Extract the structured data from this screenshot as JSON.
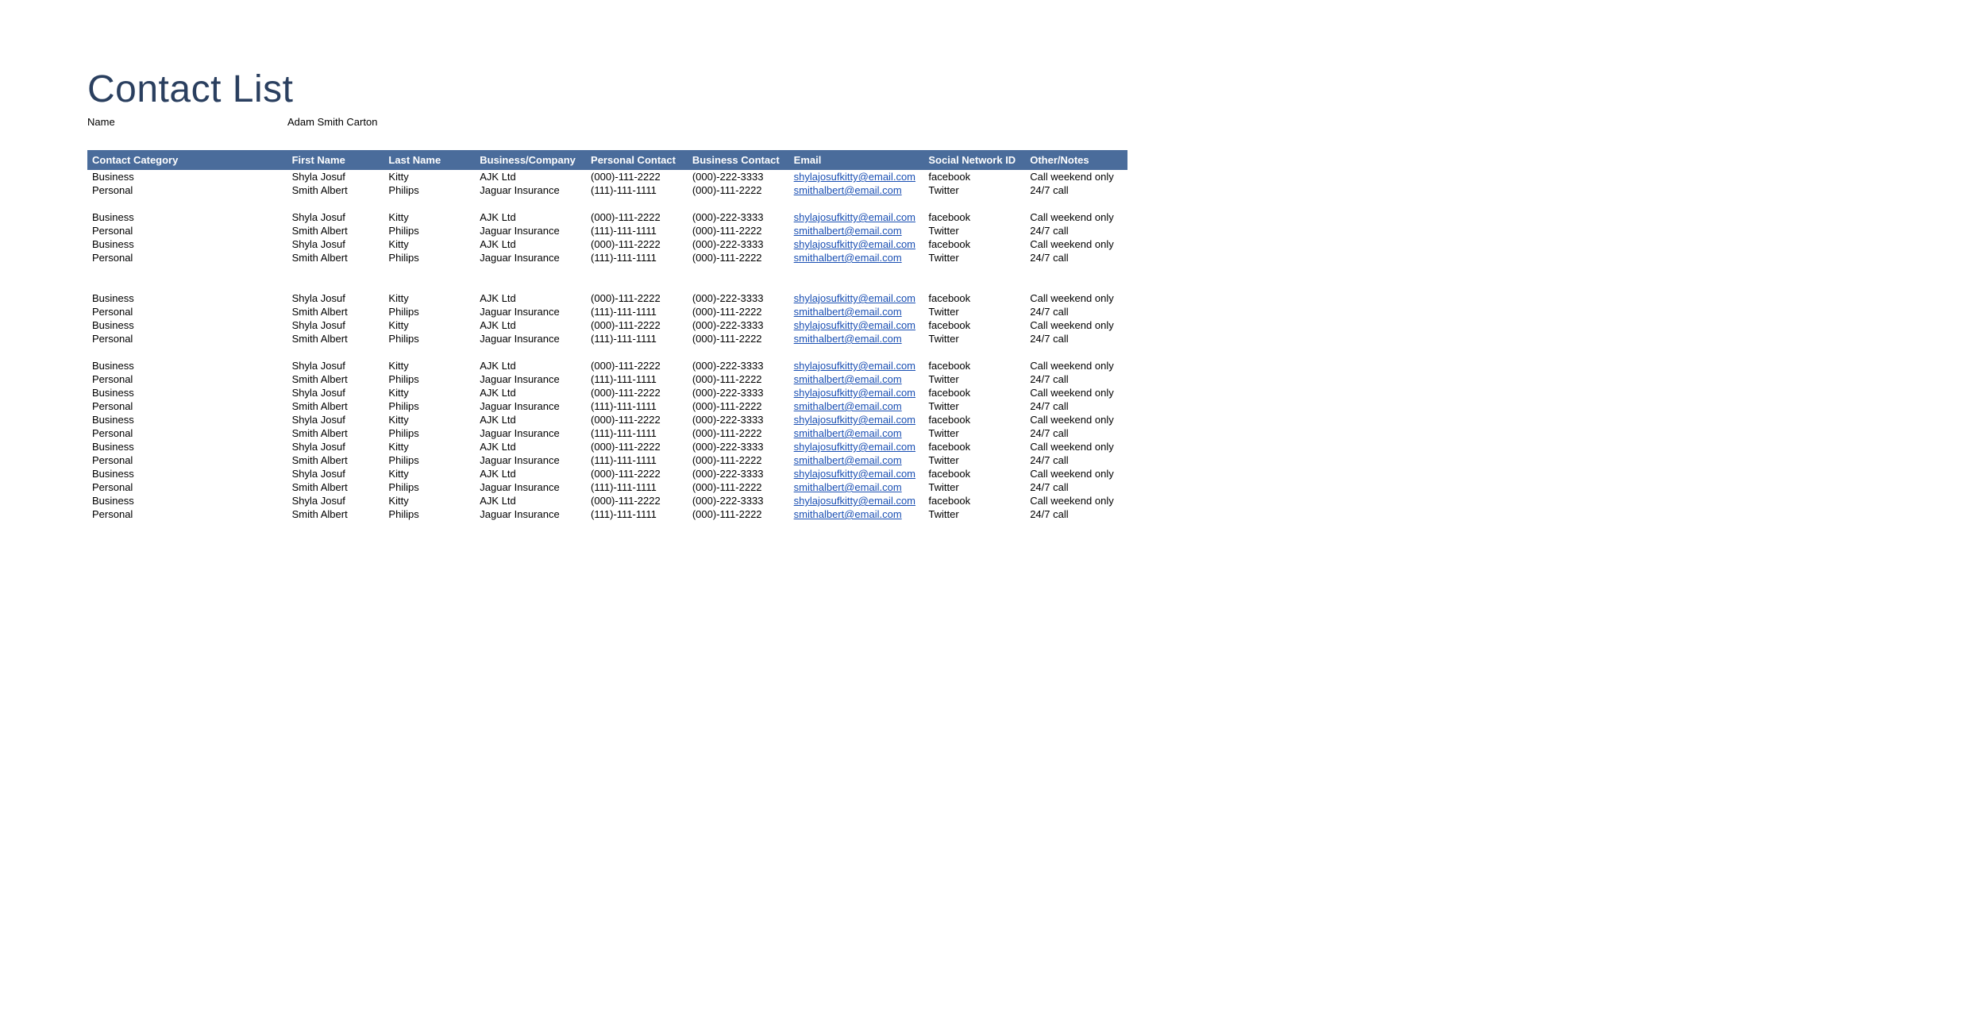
{
  "title": "Contact List",
  "meta": {
    "label": "Name",
    "value": "Adam Smith Carton"
  },
  "columns": [
    "Contact Category",
    "First Name",
    "Last Name",
    "Business/Company",
    "Personal Contact",
    "Business Contact",
    "Email",
    "Social Network ID",
    "Other/Notes"
  ],
  "rows": [
    {
      "blank": false,
      "cells": [
        "Business",
        "Shyla Josuf",
        "Kitty",
        "AJK Ltd",
        "(000)-111-2222",
        "(000)-222-3333",
        "shylajosufkitty@email.com",
        "facebook",
        "Call weekend only"
      ]
    },
    {
      "blank": false,
      "cells": [
        "Personal",
        "Smith Albert",
        "Philips",
        "Jaguar Insurance",
        "(111)-111-1111",
        "(000)-111-2222",
        "smithalbert@email.com",
        "Twitter",
        "24/7 call"
      ]
    },
    {
      "blank": true,
      "cells": [
        "",
        "",
        "",
        "",
        "",
        "",
        "",
        "",
        ""
      ]
    },
    {
      "blank": false,
      "cells": [
        "Business",
        "Shyla Josuf",
        "Kitty",
        "AJK Ltd",
        "(000)-111-2222",
        "(000)-222-3333",
        "shylajosufkitty@email.com",
        "facebook",
        "Call weekend only"
      ]
    },
    {
      "blank": false,
      "cells": [
        "Personal",
        "Smith Albert",
        "Philips",
        "Jaguar Insurance",
        "(111)-111-1111",
        "(000)-111-2222",
        "smithalbert@email.com",
        "Twitter",
        "24/7 call"
      ]
    },
    {
      "blank": false,
      "cells": [
        "Business",
        "Shyla Josuf",
        "Kitty",
        "AJK Ltd",
        "(000)-111-2222",
        "(000)-222-3333",
        "shylajosufkitty@email.com",
        "facebook",
        "Call weekend only"
      ]
    },
    {
      "blank": false,
      "cells": [
        "Personal",
        "Smith Albert",
        "Philips",
        "Jaguar Insurance",
        "(111)-111-1111",
        "(000)-111-2222",
        "smithalbert@email.com",
        "Twitter",
        "24/7 call"
      ]
    },
    {
      "blank": true,
      "cells": [
        "",
        "",
        "",
        "",
        "",
        "",
        "",
        "",
        ""
      ]
    },
    {
      "blank": true,
      "cells": [
        "",
        "",
        "",
        "",
        "",
        "",
        "",
        "",
        ""
      ]
    },
    {
      "blank": false,
      "cells": [
        "Business",
        "Shyla Josuf",
        "Kitty",
        "AJK Ltd",
        "(000)-111-2222",
        "(000)-222-3333",
        "shylajosufkitty@email.com",
        "facebook",
        "Call weekend only"
      ]
    },
    {
      "blank": false,
      "cells": [
        "Personal",
        "Smith Albert",
        "Philips",
        "Jaguar Insurance",
        "(111)-111-1111",
        "(000)-111-2222",
        "smithalbert@email.com",
        "Twitter",
        "24/7 call"
      ]
    },
    {
      "blank": false,
      "cells": [
        "Business",
        "Shyla Josuf",
        "Kitty",
        "AJK Ltd",
        "(000)-111-2222",
        "(000)-222-3333",
        "shylajosufkitty@email.com",
        "facebook",
        "Call weekend only"
      ]
    },
    {
      "blank": false,
      "cells": [
        "Personal",
        "Smith Albert",
        "Philips",
        "Jaguar Insurance",
        "(111)-111-1111",
        "(000)-111-2222",
        "smithalbert@email.com",
        "Twitter",
        "24/7 call"
      ]
    },
    {
      "blank": true,
      "cells": [
        "",
        "",
        "",
        "",
        "",
        "",
        "",
        "",
        ""
      ]
    },
    {
      "blank": false,
      "cells": [
        "Business",
        "Shyla Josuf",
        "Kitty",
        "AJK Ltd",
        "(000)-111-2222",
        "(000)-222-3333",
        "shylajosufkitty@email.com",
        "facebook",
        "Call weekend only"
      ]
    },
    {
      "blank": false,
      "cells": [
        "Personal",
        "Smith Albert",
        "Philips",
        "Jaguar Insurance",
        "(111)-111-1111",
        "(000)-111-2222",
        "smithalbert@email.com",
        "Twitter",
        "24/7 call"
      ]
    },
    {
      "blank": false,
      "cells": [
        "Business",
        "Shyla Josuf",
        "Kitty",
        "AJK Ltd",
        "(000)-111-2222",
        "(000)-222-3333",
        "shylajosufkitty@email.com",
        "facebook",
        "Call weekend only"
      ]
    },
    {
      "blank": false,
      "cells": [
        "Personal",
        "Smith Albert",
        "Philips",
        "Jaguar Insurance",
        "(111)-111-1111",
        "(000)-111-2222",
        "smithalbert@email.com",
        "Twitter",
        "24/7 call"
      ]
    },
    {
      "blank": false,
      "cells": [
        "Business",
        "Shyla Josuf",
        "Kitty",
        "AJK Ltd",
        "(000)-111-2222",
        "(000)-222-3333",
        "shylajosufkitty@email.com",
        "facebook",
        "Call weekend only"
      ]
    },
    {
      "blank": false,
      "cells": [
        "Personal",
        "Smith Albert",
        "Philips",
        "Jaguar Insurance",
        "(111)-111-1111",
        "(000)-111-2222",
        "smithalbert@email.com",
        "Twitter",
        "24/7 call"
      ]
    },
    {
      "blank": false,
      "cells": [
        "Business",
        "Shyla Josuf",
        "Kitty",
        "AJK Ltd",
        "(000)-111-2222",
        "(000)-222-3333",
        "shylajosufkitty@email.com",
        "facebook",
        "Call weekend only"
      ]
    },
    {
      "blank": false,
      "cells": [
        "Personal",
        "Smith Albert",
        "Philips",
        "Jaguar Insurance",
        "(111)-111-1111",
        "(000)-111-2222",
        "smithalbert@email.com",
        "Twitter",
        "24/7 call"
      ]
    },
    {
      "blank": false,
      "cells": [
        "Business",
        "Shyla Josuf",
        "Kitty",
        "AJK Ltd",
        "(000)-111-2222",
        "(000)-222-3333",
        "shylajosufkitty@email.com",
        "facebook",
        "Call weekend only"
      ]
    },
    {
      "blank": false,
      "cells": [
        "Personal",
        "Smith Albert",
        "Philips",
        "Jaguar Insurance",
        "(111)-111-1111",
        "(000)-111-2222",
        "smithalbert@email.com",
        "Twitter",
        "24/7 call"
      ]
    },
    {
      "blank": false,
      "cells": [
        "Business",
        "Shyla Josuf",
        "Kitty",
        "AJK Ltd",
        "(000)-111-2222",
        "(000)-222-3333",
        "shylajosufkitty@email.com",
        "facebook",
        "Call weekend only"
      ]
    },
    {
      "blank": false,
      "cells": [
        "Personal",
        "Smith Albert",
        "Philips",
        "Jaguar Insurance",
        "(111)-111-1111",
        "(000)-111-2222",
        "smithalbert@email.com",
        "Twitter",
        "24/7 call"
      ]
    }
  ]
}
